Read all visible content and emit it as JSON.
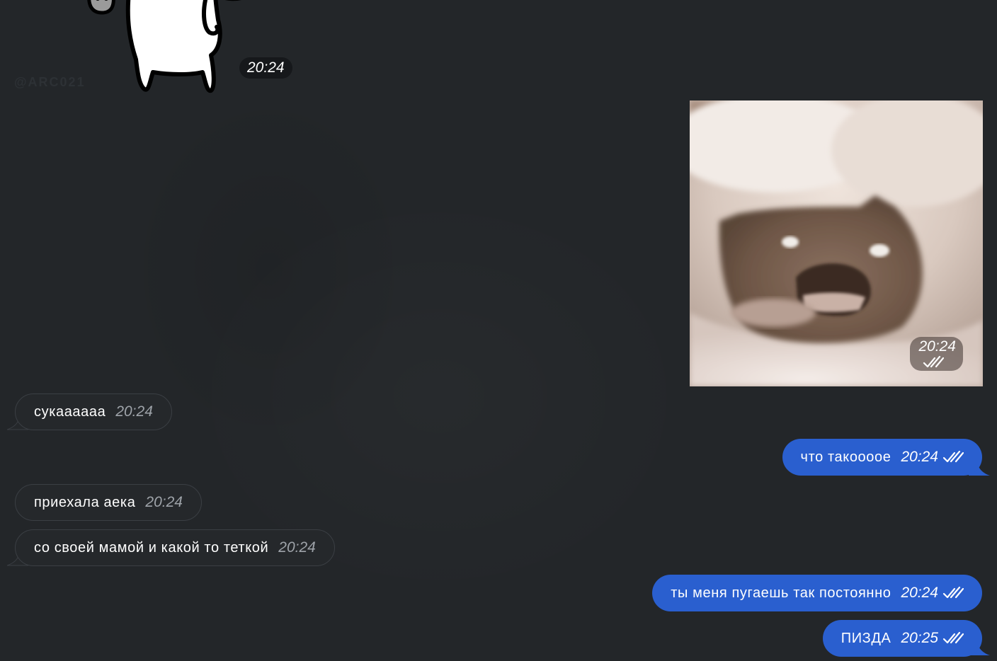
{
  "chat": {
    "watermark": "@ARC021",
    "sticker": {
      "time": "20:24"
    },
    "photo": {
      "time": "20:24",
      "read_status": "read"
    },
    "messages": [
      {
        "direction": "incoming",
        "text": "сукаааааа",
        "time": "20:24"
      },
      {
        "direction": "outgoing",
        "text": "что такоооое",
        "time": "20:24",
        "read_status": "read"
      },
      {
        "direction": "incoming",
        "text": "приехала аека",
        "time": "20:24"
      },
      {
        "direction": "incoming",
        "text": "со своей мамой и какой то теткой",
        "time": "20:24"
      },
      {
        "direction": "outgoing",
        "text": "ты меня пугаешь так постоянно",
        "time": "20:24",
        "read_status": "read"
      },
      {
        "direction": "outgoing",
        "text": "ПИЗДА",
        "time": "20:25",
        "read_status": "read"
      }
    ]
  },
  "colors": {
    "background": "#232629",
    "incoming_bubble": "#25282b",
    "outgoing_bubble": "#2a5fcf",
    "incoming_time": "#9ea3a9"
  }
}
